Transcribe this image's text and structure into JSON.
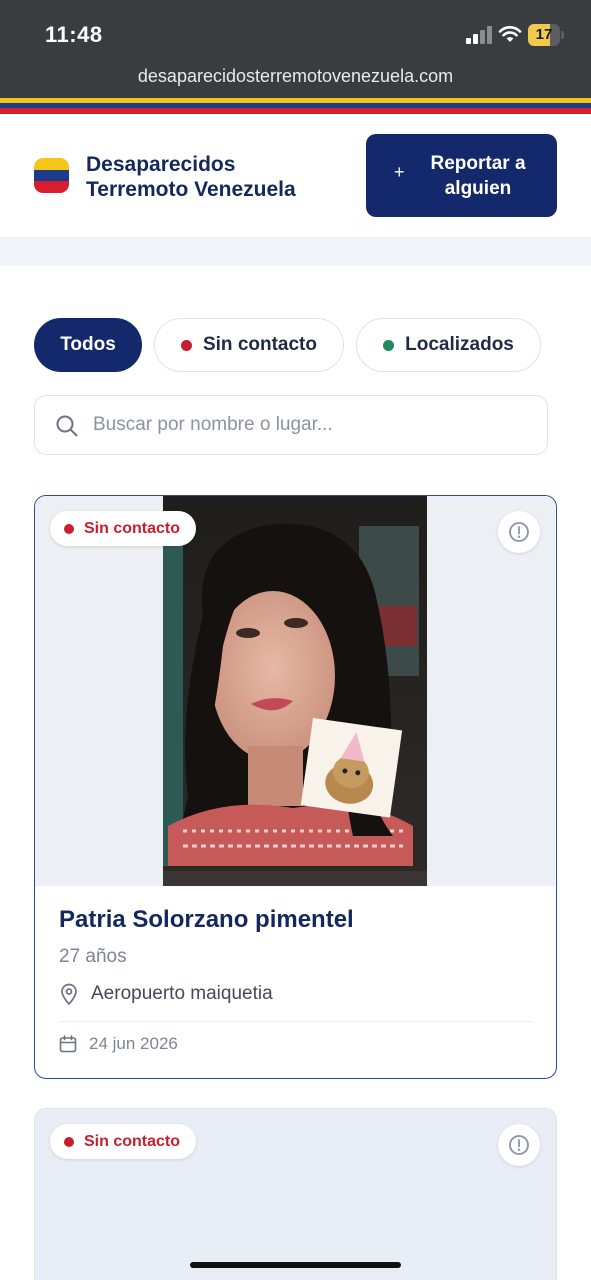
{
  "status_bar": {
    "time": "11:48",
    "battery_level": "17",
    "battery_color": "#f2c94c"
  },
  "browser": {
    "url": "desaparecidosterremotovenezuela.com"
  },
  "flag_colors": {
    "yellow": "#f5c518",
    "blue": "#1e3a8a",
    "red": "#d61e2f"
  },
  "header": {
    "brand_line1": "Desaparecidos",
    "brand_line2": "Terremoto Venezuela",
    "report_button": {
      "icon": "plus-icon",
      "label_line1": "Reportar a",
      "label_line2": "alguien"
    }
  },
  "filters": [
    {
      "label": "Todos",
      "active": true
    },
    {
      "label": "Sin contacto",
      "dot_color": "#c81e2d"
    },
    {
      "label": "Localizados",
      "dot_color": "#1f8a5b"
    }
  ],
  "search": {
    "placeholder": "Buscar por nombre o lugar...",
    "icon": "search-icon"
  },
  "cards": [
    {
      "status": "Sin contacto",
      "status_color": "#c81e2d",
      "name": "Patria Solorzano pimentel",
      "age": "27 años",
      "location": "Aeropuerto maiquetia",
      "date": "24 jun 2026"
    },
    {
      "status": "Sin contacto",
      "status_color": "#c81e2d"
    }
  ]
}
